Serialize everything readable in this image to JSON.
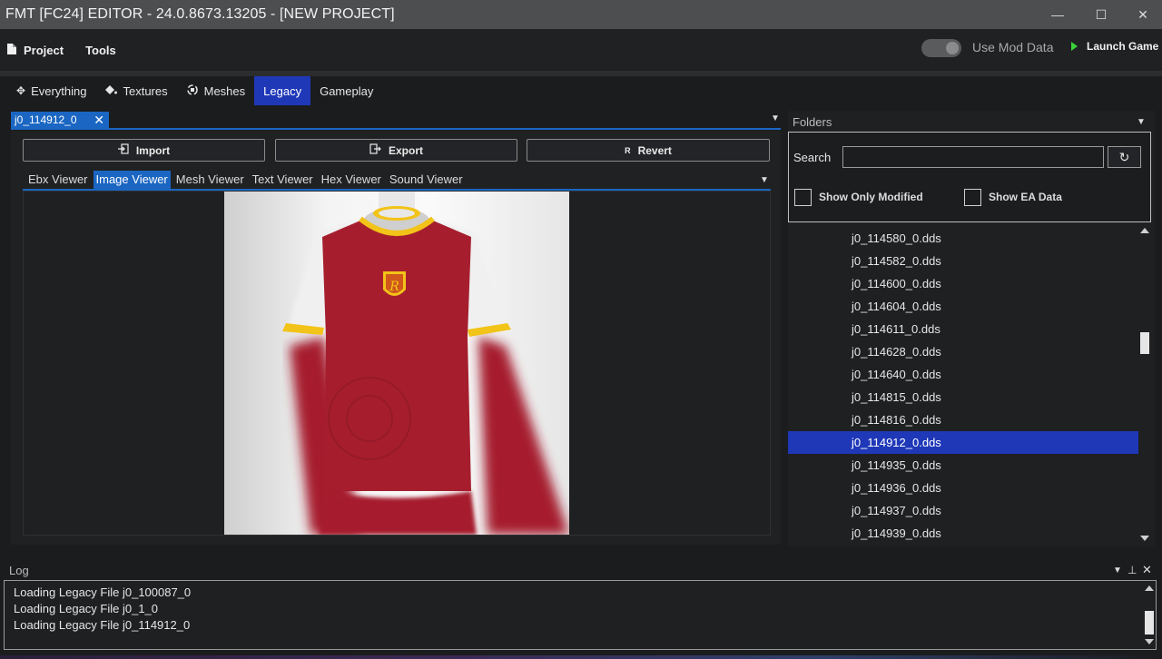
{
  "window": {
    "title": "FMT [FC24] EDITOR - 24.0.8673.13205 - [NEW PROJECT]",
    "minimize": "—",
    "maximize": "☐",
    "close": "✕"
  },
  "menu": {
    "project_label": "Project",
    "tools_label": "Tools",
    "use_mod_data_label": "Use Mod Data",
    "use_mod_data_enabled": false,
    "launch_game_label": "Launch Game"
  },
  "main_tabs": [
    {
      "label": "Everything",
      "icon": "move-arrows-icon",
      "active": false
    },
    {
      "label": "Textures",
      "icon": "paint-bucket-icon",
      "active": false
    },
    {
      "label": "Meshes",
      "icon": "mesh-rotate-icon",
      "active": false
    },
    {
      "label": "Legacy",
      "icon": "",
      "active": true
    },
    {
      "label": "Gameplay",
      "icon": "",
      "active": false
    }
  ],
  "document": {
    "tab_title": "j0_114912_0",
    "close_glyph": "✕"
  },
  "actions": {
    "import_label": "Import",
    "export_label": "Export",
    "revert_label": "Revert",
    "revert_icon_text": "R"
  },
  "viewer_tabs": [
    {
      "label": "Ebx Viewer",
      "active": false
    },
    {
      "label": "Image Viewer",
      "active": true
    },
    {
      "label": "Mesh Viewer",
      "active": false
    },
    {
      "label": "Text Viewer",
      "active": false
    },
    {
      "label": "Hex Viewer",
      "active": false
    },
    {
      "label": "Sound Viewer",
      "active": false
    }
  ],
  "folders": {
    "panel_label": "Folders",
    "search_label": "Search",
    "search_value": "",
    "show_only_modified_label": "Show Only Modified",
    "show_only_modified_checked": false,
    "show_ea_data_label": "Show EA Data",
    "show_ea_data_checked": false,
    "files": [
      {
        "name": "j0_114580_0.dds",
        "selected": false
      },
      {
        "name": "j0_114582_0.dds",
        "selected": false
      },
      {
        "name": "j0_114600_0.dds",
        "selected": false
      },
      {
        "name": "j0_114604_0.dds",
        "selected": false
      },
      {
        "name": "j0_114611_0.dds",
        "selected": false
      },
      {
        "name": "j0_114628_0.dds",
        "selected": false
      },
      {
        "name": "j0_114640_0.dds",
        "selected": false
      },
      {
        "name": "j0_114815_0.dds",
        "selected": false
      },
      {
        "name": "j0_114816_0.dds",
        "selected": false
      },
      {
        "name": "j0_114912_0.dds",
        "selected": true
      },
      {
        "name": "j0_114935_0.dds",
        "selected": false
      },
      {
        "name": "j0_114936_0.dds",
        "selected": false
      },
      {
        "name": "j0_114937_0.dds",
        "selected": false
      },
      {
        "name": "j0_114939_0.dds",
        "selected": false
      }
    ]
  },
  "log": {
    "panel_label": "Log",
    "lines": [
      "Loading Legacy File j0_100087_0",
      "Loading Legacy File j0_1_0",
      "Loading Legacy File j0_114912_0"
    ]
  },
  "colors": {
    "accent_blue": "#1a66c2",
    "selection_blue": "#1f38b8",
    "launch_green": "#3bd13b",
    "jersey_red": "#a61e2e",
    "jersey_trim": "#f2c318"
  }
}
